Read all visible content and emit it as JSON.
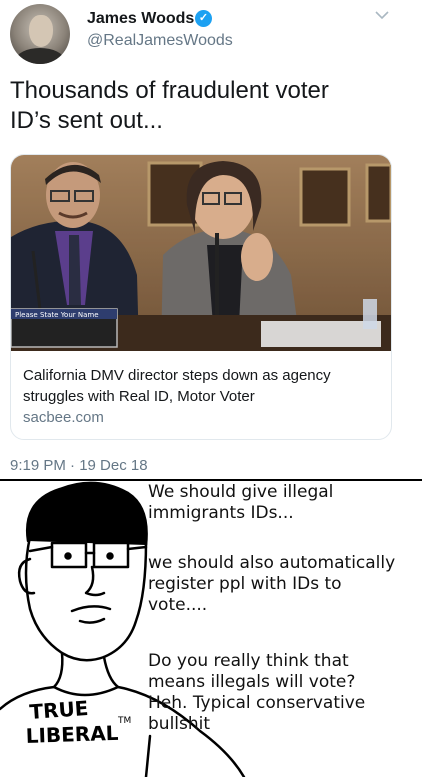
{
  "tweet": {
    "display_name": "James Woods",
    "handle": "@RealJamesWoods",
    "text_line1": "Thousands of fraudulent voter",
    "text_line2": "ID’s sent out...",
    "timestamp": "9:19 PM · 19 Dec 18",
    "card": {
      "image_banner_text": "Please State Your Name",
      "title_line1": "California DMV director steps down as agency",
      "title_line2": "struggles with Real ID, Motor Voter",
      "domain": "sacbee.com"
    }
  },
  "comic": {
    "caption1_line1": "We should give illegal",
    "caption1_line2": "immigrants IDs...",
    "caption2_line1": "we should also automatically",
    "caption2_line2": "register ppl with IDs to",
    "caption2_line3": "vote....",
    "caption3_line1": "Do you really think that",
    "caption3_line2": "means illegals will vote?",
    "caption3_line3": "Heh. Typical conservative",
    "caption3_line4": "bullshit",
    "shirt_line1": "TRUE",
    "shirt_line2": "LIBERAL",
    "shirt_tm": "TM"
  },
  "colors": {
    "accent": "#1da1f2",
    "secondary_text": "#657786",
    "card_border": "#e1e8ed"
  }
}
